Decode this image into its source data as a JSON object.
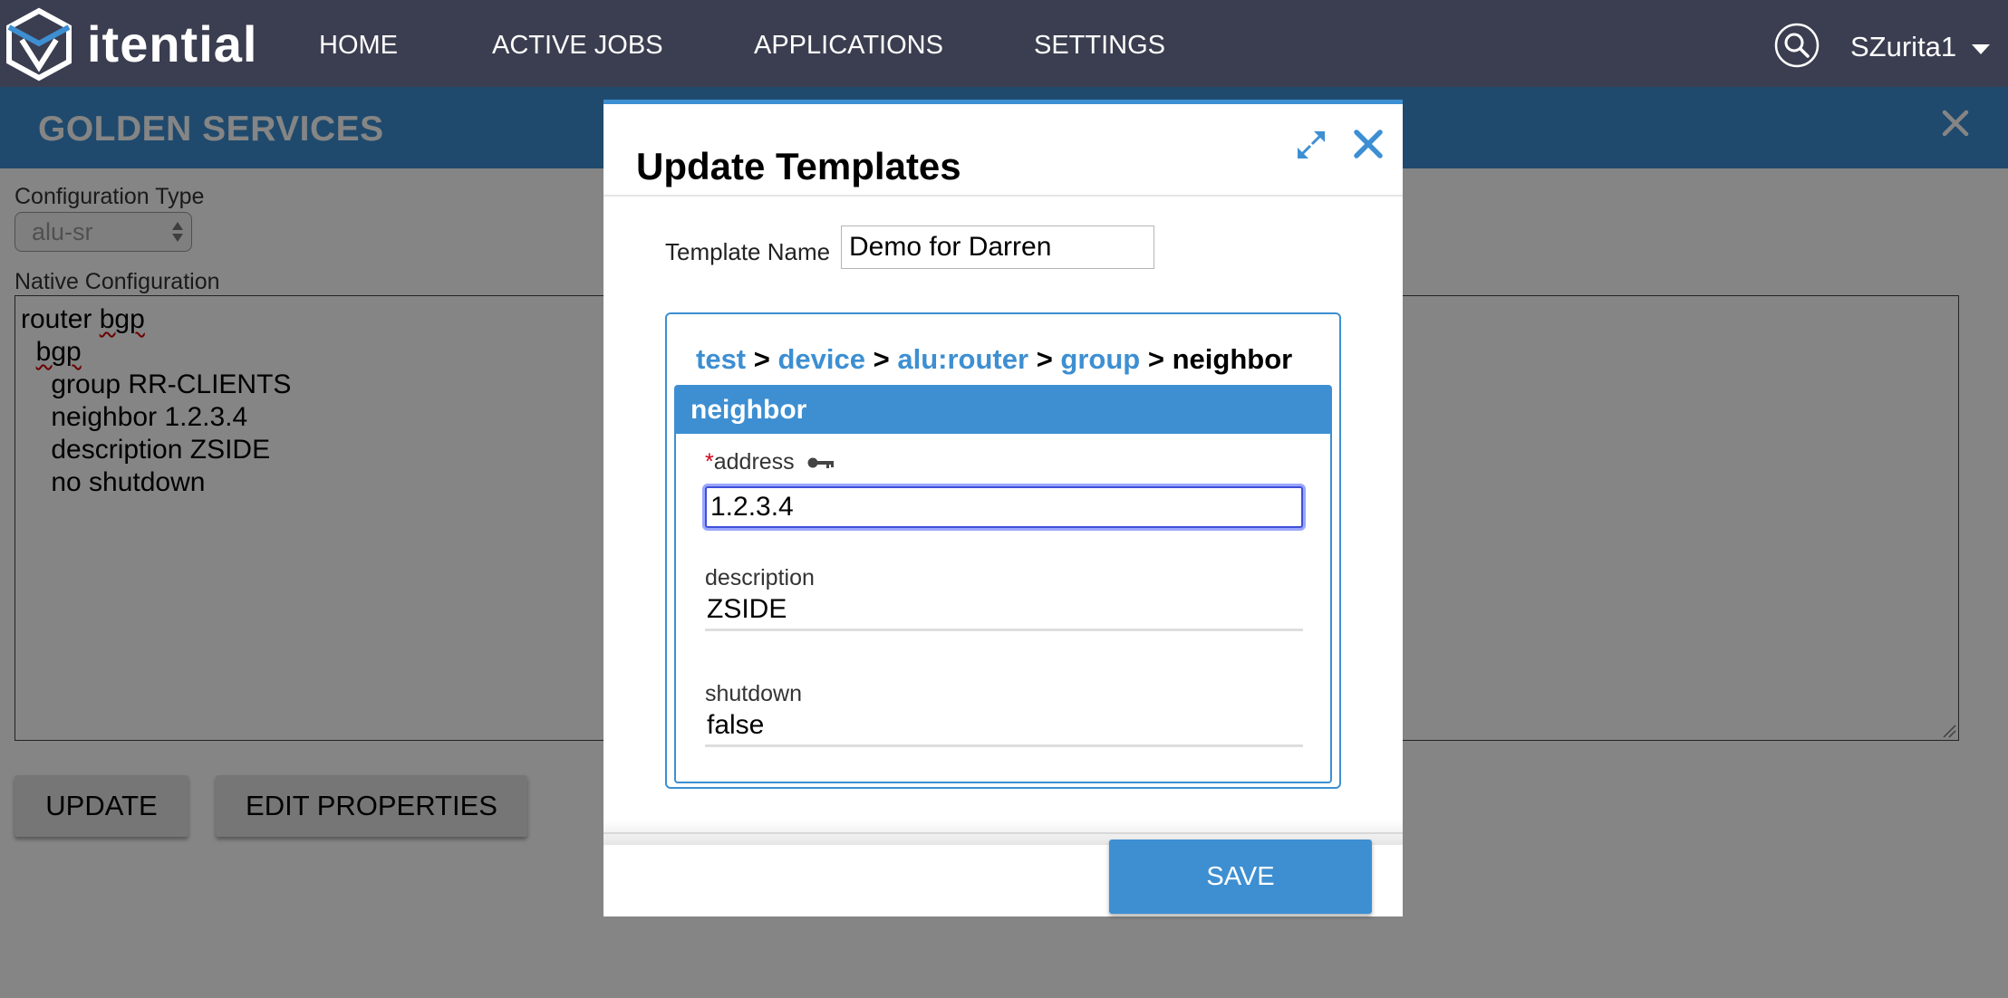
{
  "nav": {
    "brand": "itential",
    "items": [
      {
        "label": "HOME"
      },
      {
        "label": "ACTIVE JOBS"
      },
      {
        "label": "APPLICATIONS"
      },
      {
        "label": "SETTINGS"
      }
    ],
    "user": "SZurita1"
  },
  "page": {
    "title": "GOLDEN SERVICES",
    "config_type_label": "Configuration Type",
    "config_type_value": "alu-sr",
    "native_config_label": "Native Configuration",
    "native_config_lines": [
      "router bgp",
      "  bgp",
      "    group RR-CLIENTS",
      "    neighbor 1.2.3.4",
      "    description ZSIDE",
      "    no shutdown"
    ],
    "update_button": "UPDATE",
    "edit_properties_button": "EDIT PROPERTIES"
  },
  "modal": {
    "title": "Update Templates",
    "template_name_label": "Template Name",
    "template_name_value": "Demo for Darren",
    "breadcrumb": {
      "links": [
        "test",
        "device",
        "alu:router",
        "group"
      ],
      "separator": ">",
      "current": "neighbor"
    },
    "node": {
      "header": "neighbor",
      "fields": [
        {
          "required_mark": "*",
          "label": "address",
          "value": "1.2.3.4"
        },
        {
          "label": "description",
          "value": "ZSIDE"
        },
        {
          "label": "shutdown",
          "value": "false"
        }
      ]
    },
    "save_button": "SAVE"
  },
  "colors": {
    "nav_bg": "#3b3e50",
    "accent": "#3d8fd2",
    "required": "#d0021b",
    "focus": "#3f4fd9"
  },
  "icons": [
    "itential-logo-icon",
    "search-icon",
    "chevron-down-icon",
    "close-icon",
    "expand-icon",
    "key-icon",
    "resize-grip-icon",
    "select-arrows-icon"
  ]
}
